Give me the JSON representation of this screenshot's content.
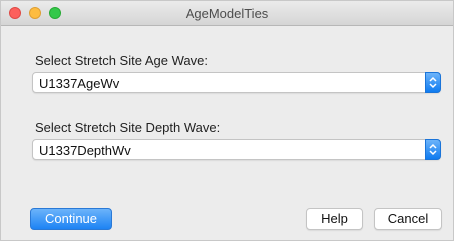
{
  "window": {
    "title": "AgeModelTies"
  },
  "age_wave": {
    "label": "Select Stretch Site Age Wave:",
    "selected": "U1337AgeWv"
  },
  "depth_wave": {
    "label": "Select Stretch Site Depth Wave:",
    "selected": "U1337DepthWv"
  },
  "buttons": {
    "continue": "Continue",
    "help": "Help",
    "cancel": "Cancel"
  },
  "colors": {
    "accent": "#1d83f4",
    "close": "#fc605c",
    "minimize": "#fdbc40",
    "maximize": "#34c84a"
  },
  "icons": {
    "close": "close-icon",
    "minimize": "minimize-icon",
    "maximize": "maximize-icon",
    "popup_arrows": "chevron-updown-icon"
  }
}
